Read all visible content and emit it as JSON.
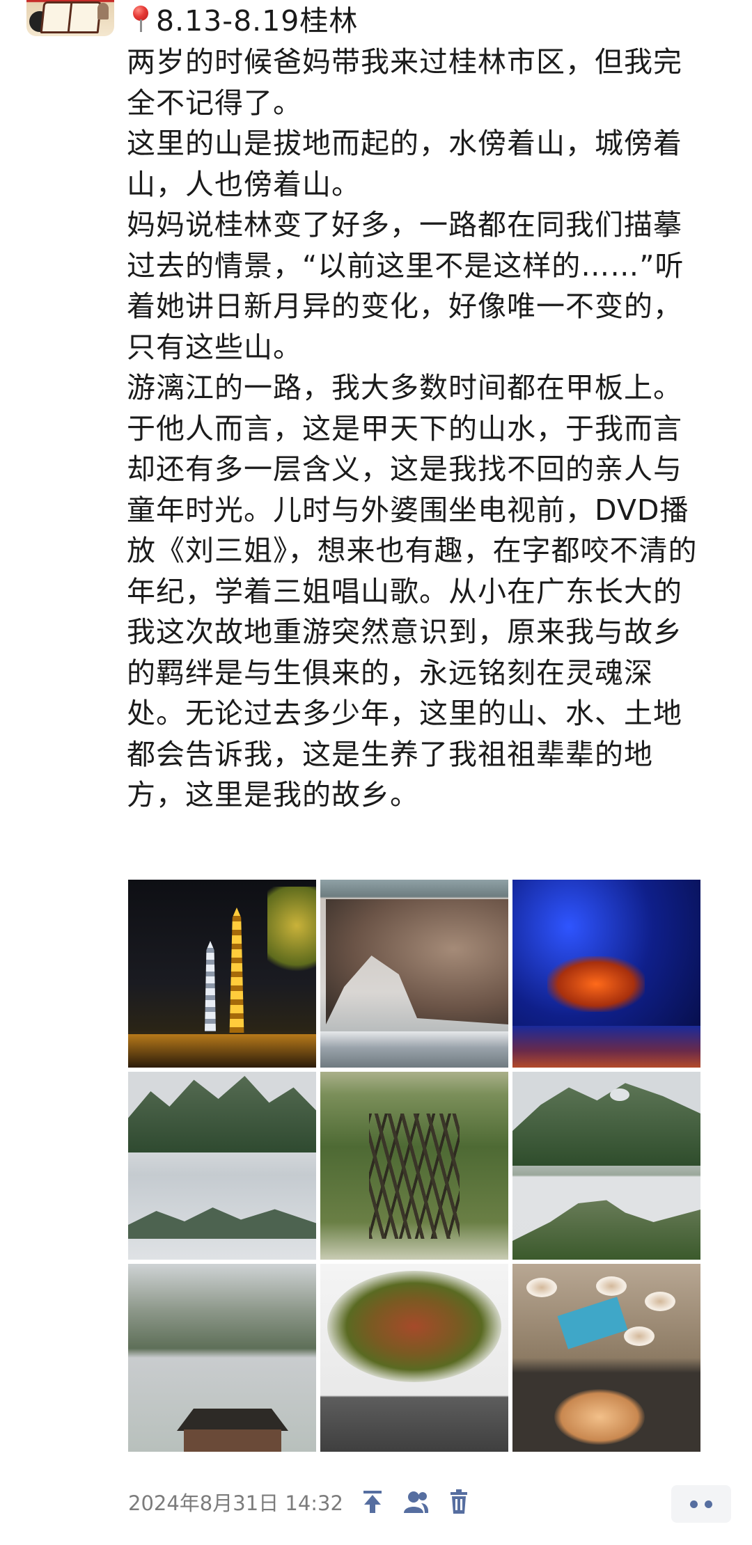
{
  "post": {
    "header": "8.13-8.19桂林",
    "paragraphs": [
      "两岁的时候爸妈带我来过桂林市区，但我完全不记得了。",
      "这里的山是拔地而起的，水傍着山，城傍着山，人也傍着山。",
      "妈妈说桂林变了好多，一路都在同我们描摹过去的情景，“以前这里不是这样的……”听着她讲日新月异的变化，好像唯一不变的，只有这些山。",
      "游漓江的一路，我大多数时间都在甲板上。于他人而言，这是甲天下的山水，于我而言却还有多一层含义，这是我找不回的亲人与童年时光。儿时与外婆围坐电视前，DVD播放《刘三姐》，想来也有趣，在字都咬不清的年纪，学着三姐唱山歌。从小在广东长大的我这次故地重游突然意识到，原来我与故乡的羁绊是与生俱来的，永远铭刻在灵魂深处。无论过去多少年，这里的山、水、土地都会告诉我，这是生养了我祖祖辈辈的地方，这里是我的故乡。"
    ]
  },
  "photos": [
    {
      "subject": "night pagodas"
    },
    {
      "subject": "rock arch by river"
    },
    {
      "subject": "illuminated cave"
    },
    {
      "subject": "karst river"
    },
    {
      "subject": "banyan tree"
    },
    {
      "subject": "moon hill"
    },
    {
      "subject": "karst town and gate"
    },
    {
      "subject": "braised dish"
    },
    {
      "subject": "dinner table"
    }
  ],
  "footer": {
    "timestamp": "2024年8月31日 14:32"
  },
  "icons": {
    "pin": "pin-icon",
    "top": "pin-to-top-icon",
    "visibility": "visibility-user-icon",
    "delete": "trash-icon",
    "more": "more-dots-icon"
  },
  "colors": {
    "text": "#1b1b1b",
    "timestamp": "#7c7c7c",
    "icon": "#566ea0",
    "more_bg": "#f3f4f6"
  }
}
